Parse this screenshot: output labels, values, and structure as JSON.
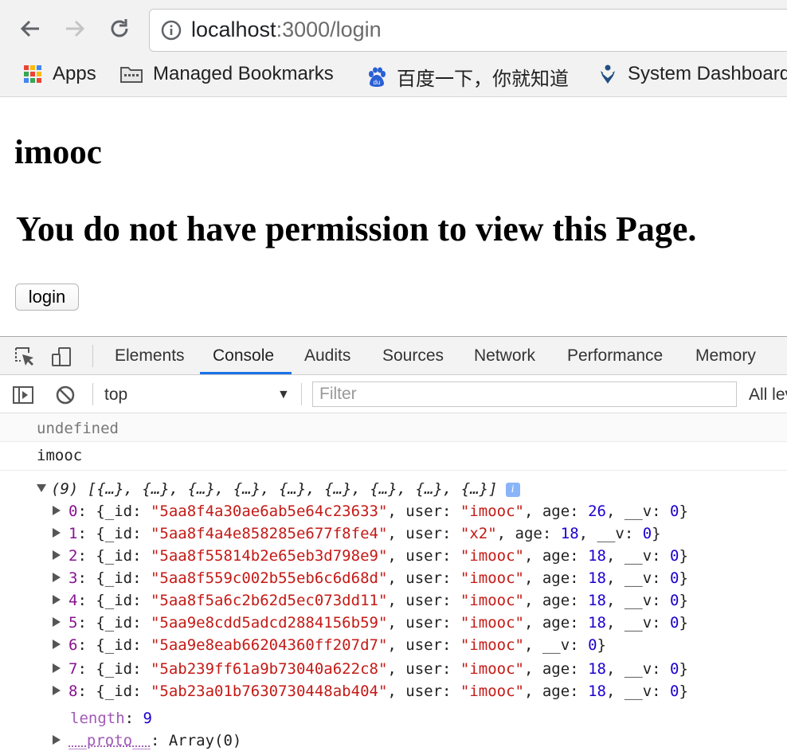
{
  "browser": {
    "url_host": "localhost",
    "url_rest": ":3000/login",
    "bookmarks": [
      {
        "label": "Apps",
        "icon": "apps-grid-icon"
      },
      {
        "label": "Managed Bookmarks",
        "icon": "folder-icon"
      },
      {
        "label": "百度一下，你就知道",
        "icon": "baidu-paw-icon"
      },
      {
        "label": "System Dashboard",
        "icon": "jira-icon"
      }
    ]
  },
  "page": {
    "h1": "imooc",
    "h2": "You do not have permission to view this Page.",
    "button_label": "login"
  },
  "devtools": {
    "tabs": [
      "Elements",
      "Console",
      "Audits",
      "Sources",
      "Network",
      "Performance",
      "Memory"
    ],
    "active_tab": "Console",
    "context": "top",
    "filter_placeholder": "Filter",
    "levels_label": "All levels"
  },
  "console": {
    "line1": "undefined",
    "line2": "imooc",
    "array_summary": "(9) [{…}, {…}, {…}, {…}, {…}, {…}, {…}, {…}, {…}]",
    "rows": [
      {
        "index": "0",
        "id": "5aa8f4a30ae6ab5e64c23633",
        "user": "imooc",
        "age": "26",
        "v": "0"
      },
      {
        "index": "1",
        "id": "5aa8f4a4e858285e677f8fe4",
        "user": "x2",
        "age": "18",
        "v": "0"
      },
      {
        "index": "2",
        "id": "5aa8f55814b2e65eb3d798e9",
        "user": "imooc",
        "age": "18",
        "v": "0"
      },
      {
        "index": "3",
        "id": "5aa8f559c002b55eb6c6d68d",
        "user": "imooc",
        "age": "18",
        "v": "0"
      },
      {
        "index": "4",
        "id": "5aa8f5a6c2b62d5ec073dd11",
        "user": "imooc",
        "age": "18",
        "v": "0"
      },
      {
        "index": "5",
        "id": "5aa9e8cdd5adcd2884156b59",
        "user": "imooc",
        "age": "18",
        "v": "0"
      },
      {
        "index": "6",
        "id": "5aa9e8eab66204360ff207d7",
        "user": "imooc",
        "age": null,
        "v": "0"
      },
      {
        "index": "7",
        "id": "5ab239ff61a9b73040a622c8",
        "user": "imooc",
        "age": "18",
        "v": "0"
      },
      {
        "index": "8",
        "id": "5ab23a01b7630730448ab404",
        "user": "imooc",
        "age": "18",
        "v": "0"
      }
    ],
    "length_key": "length",
    "length_value": "9",
    "proto_key": "__proto__",
    "proto_value": "Array(0)"
  }
}
